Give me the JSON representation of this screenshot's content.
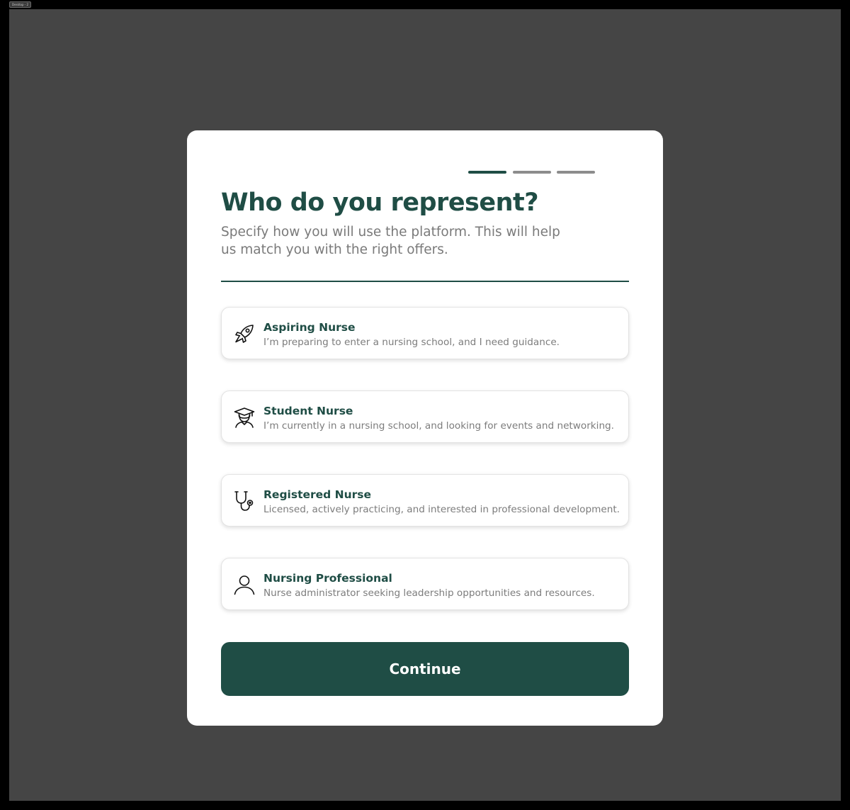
{
  "frame": {
    "label": "Desktop - 2"
  },
  "colors": {
    "brand": "#1f4d45",
    "step_inactive": "#8c8c8c",
    "modal_bg": "#ffffff",
    "canvas_bg": "#454545"
  },
  "progress": {
    "current_step": 1,
    "total_steps": 3
  },
  "header": {
    "title": "Who do you represent?",
    "subtitle": "Specify how you will use the platform. This will help us match you with the right offers."
  },
  "options": [
    {
      "icon": "rocket-icon",
      "title": "Aspiring Nurse",
      "description": "I’m preparing to enter a nursing school, and I need guidance."
    },
    {
      "icon": "graduate-icon",
      "title": "Student Nurse",
      "description": "I’m currently in a nursing school, and looking for events and networking."
    },
    {
      "icon": "stethoscope-icon",
      "title": "Registered Nurse",
      "description": "Licensed, actively practicing, and interested in professional development."
    },
    {
      "icon": "user-icon",
      "title": "Nursing Professional",
      "description": "Nurse administrator seeking leadership opportunities and resources."
    }
  ],
  "actions": {
    "continue_label": "Continue"
  }
}
